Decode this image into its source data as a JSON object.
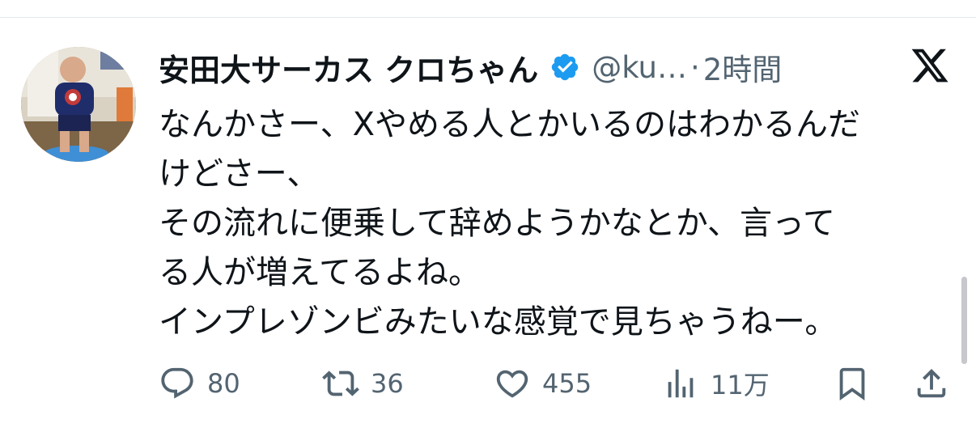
{
  "tweet": {
    "author_name": "安田大サーカス クロちゃん",
    "handle": "@ku…",
    "separator": "·",
    "time": "2時間",
    "verified": true,
    "text_lines": [
      "なんかさー、Xやめる人とかいるのはわかるんだ",
      "けどさー、",
      "その流れに便乗して辞めようかなとか、言って",
      "る人が増えてるよね。",
      "インプレゾンビみたいな感覚で見ちゃうねー。"
    ]
  },
  "actions": {
    "reply": {
      "icon": "reply-icon",
      "count": "80"
    },
    "retweet": {
      "icon": "retweet-icon",
      "count": "36"
    },
    "like": {
      "icon": "heart-icon",
      "count": "455"
    },
    "views": {
      "icon": "views-icon",
      "count": "11万"
    },
    "bookmark": {
      "icon": "bookmark-icon"
    },
    "share": {
      "icon": "share-icon"
    }
  },
  "colors": {
    "text": "#0f1419",
    "secondary": "#536471",
    "verified": "#1d9bf0",
    "background": "#ffffff"
  }
}
